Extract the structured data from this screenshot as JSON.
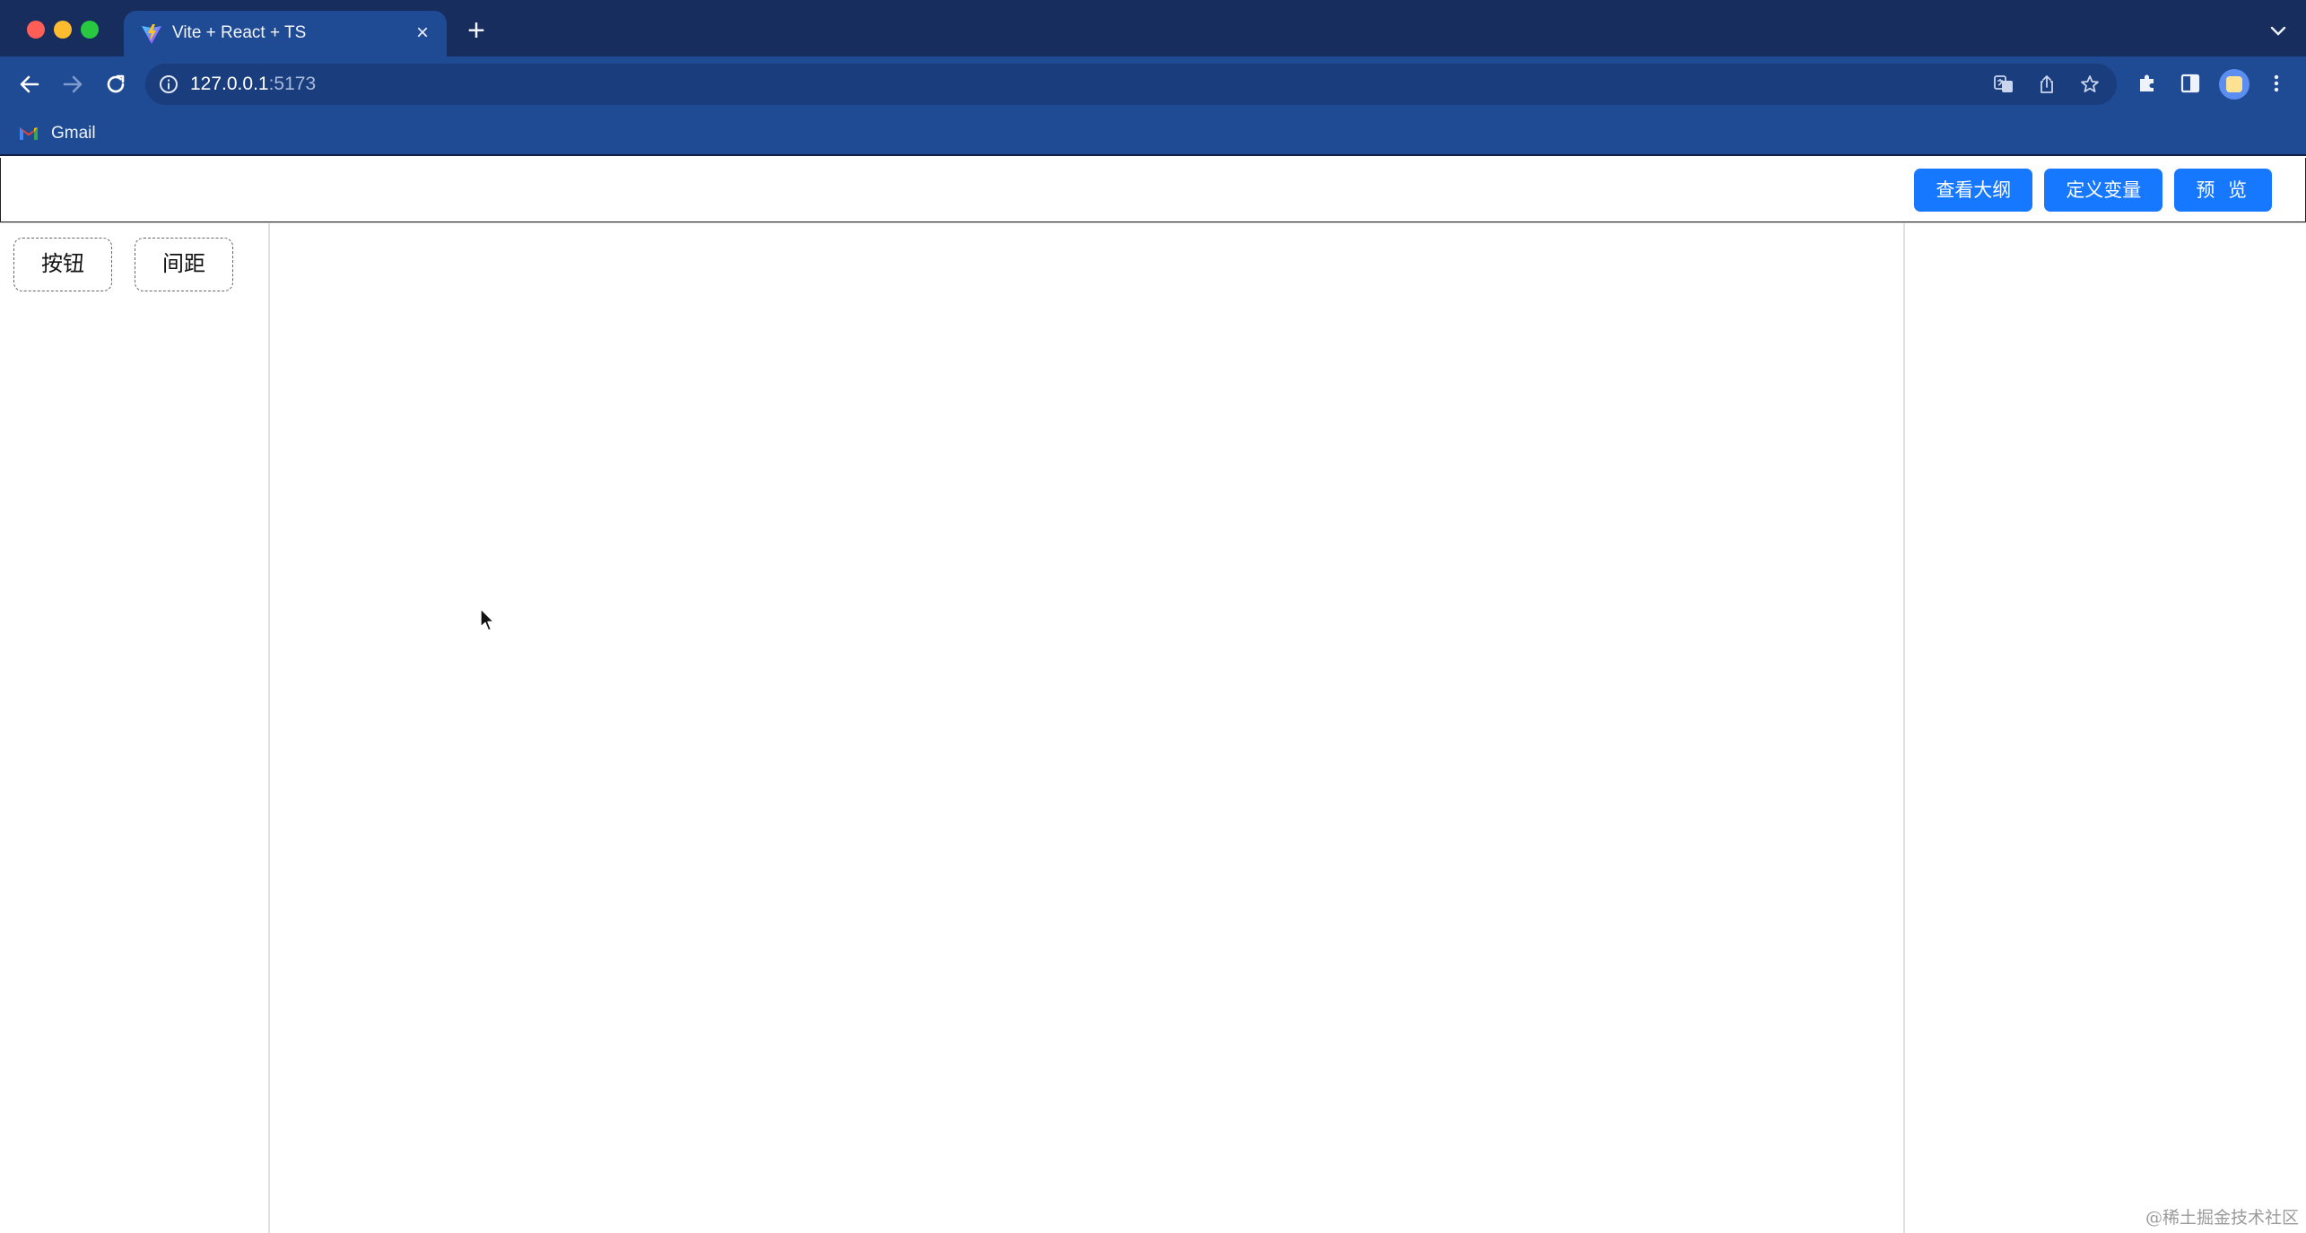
{
  "browser": {
    "tab": {
      "title": "Vite + React + TS",
      "favicon": "vite-logo-icon",
      "close": "×"
    },
    "new_tab": "+",
    "address": {
      "host": "127.0.0.1",
      "port": ":5173"
    },
    "bookmarks": [
      {
        "label": "Gmail",
        "icon": "gmail-icon"
      }
    ]
  },
  "app": {
    "header": {
      "actions": [
        {
          "label": "查看大纲"
        },
        {
          "label": "定义变量"
        },
        {
          "label": "预 览"
        }
      ]
    },
    "materials": [
      {
        "label": "按钮"
      },
      {
        "label": "间距"
      }
    ]
  },
  "watermark": "@稀土掘金技术社区",
  "colors": {
    "primary": "#1677ff",
    "chrome_tabstrip": "#172d5e",
    "chrome_toolbar": "#1f4a94"
  }
}
